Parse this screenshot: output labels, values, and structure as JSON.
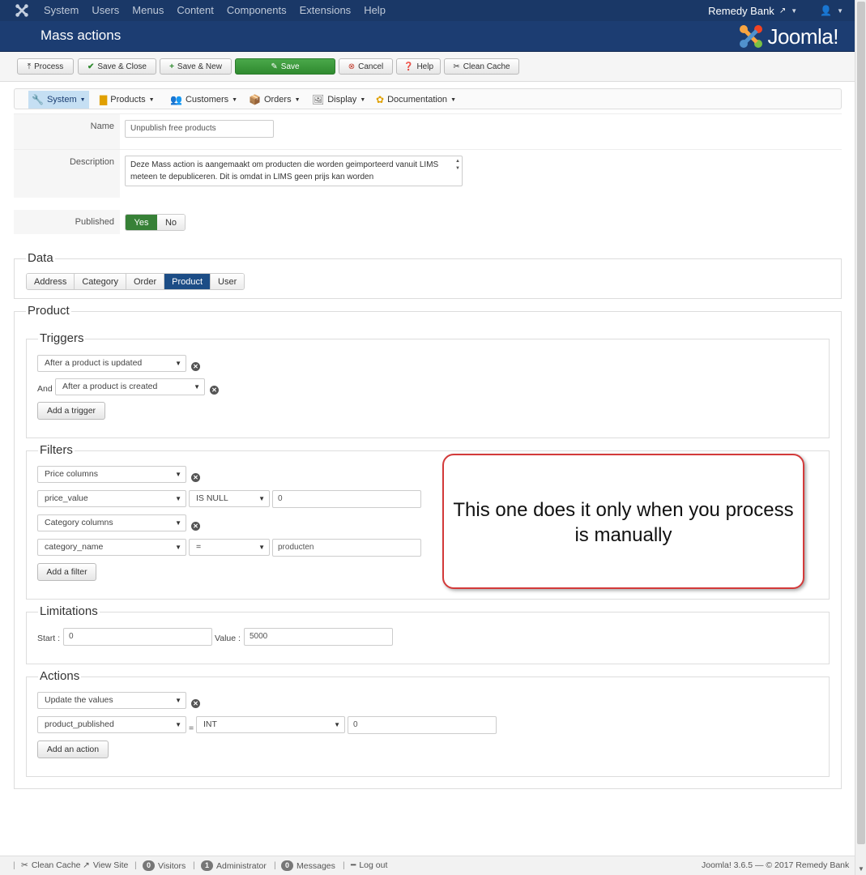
{
  "topbar": {
    "menu": [
      "System",
      "Users",
      "Menus",
      "Content",
      "Components",
      "Extensions",
      "Help"
    ],
    "site_name": "Remedy Bank"
  },
  "header": {
    "title": "Mass actions",
    "brand": "Joomla!"
  },
  "toolbar": {
    "process": "Process",
    "save_close": "Save & Close",
    "save_new": "Save & New",
    "save": "Save",
    "cancel": "Cancel",
    "help": "Help",
    "clean_cache": "Clean Cache"
  },
  "submenu": [
    "System",
    "Products",
    "Customers",
    "Orders",
    "Display",
    "Documentation"
  ],
  "form": {
    "name_label": "Name",
    "name_value": "Unpublish free products",
    "description_label": "Description",
    "description_value": "Deze Mass action is aangemaakt om producten die worden geimporteerd vanuit LIMS meteen te depubliceren. Dit is omdat in LIMS geen prijs kan worden",
    "published_label": "Published",
    "yes": "Yes",
    "no": "No"
  },
  "data": {
    "legend": "Data",
    "tabs": [
      "Address",
      "Category",
      "Order",
      "Product",
      "User"
    ],
    "active_tab": "Product"
  },
  "product": {
    "legend": "Product",
    "triggers": {
      "legend": "Triggers",
      "first": "After a product is updated",
      "and_label": "And",
      "second": "After a product is created",
      "add": "Add a trigger"
    },
    "filters": {
      "legend": "Filters",
      "group1": "Price columns",
      "col1": "price_value",
      "op1": "IS NULL",
      "val1": "0",
      "group2": "Category columns",
      "col2": "category_name",
      "op2": "=",
      "val2": "producten",
      "add": "Add a filter"
    },
    "limitations": {
      "legend": "Limitations",
      "start_label": "Start :",
      "start_value": "0",
      "value_label": "Value :",
      "value_value": "5000"
    },
    "actions": {
      "legend": "Actions",
      "type": "Update the values",
      "column": "product_published",
      "eq": "=",
      "datatype": "INT",
      "value": "0",
      "add": "Add an action"
    }
  },
  "callout": "This one does it only when you process is manually",
  "statusbar": {
    "clean_cache": "Clean Cache",
    "view_site": "View Site",
    "visitors_count": "0",
    "visitors": "Visitors",
    "admin_count": "1",
    "admin": "Administrator",
    "messages_count": "0",
    "messages": "Messages",
    "logout": "Log out",
    "version": "Joomla! 3.6.5 — © 2017 Remedy Bank"
  }
}
